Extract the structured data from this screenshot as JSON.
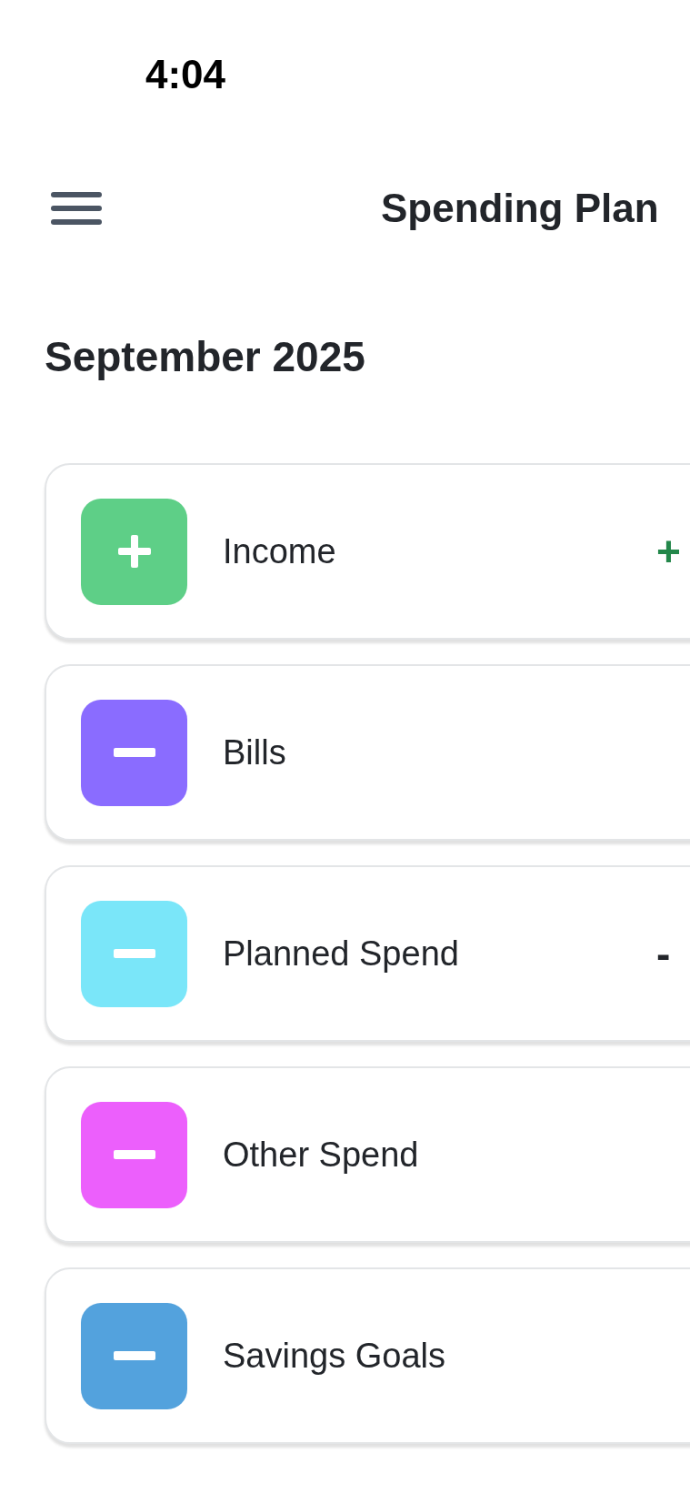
{
  "status_bar": {
    "time": "4:04"
  },
  "header": {
    "title": "Spending Plan"
  },
  "period": "September 2025",
  "categories": [
    {
      "label": "Income",
      "kind": "plus",
      "color": "#5ecf87",
      "amount": {
        "text": "+",
        "kind": "positive"
      }
    },
    {
      "label": "Bills",
      "kind": "minus",
      "color": "#8a6cff"
    },
    {
      "label": "Planned Spend",
      "kind": "minus",
      "color": "#7ae6f9",
      "amount": {
        "text": "-",
        "kind": "neutral"
      }
    },
    {
      "label": "Other Spend",
      "kind": "minus",
      "color": "#ec5ffc"
    },
    {
      "label": "Savings Goals",
      "kind": "minus",
      "color": "#53a2dd"
    }
  ]
}
